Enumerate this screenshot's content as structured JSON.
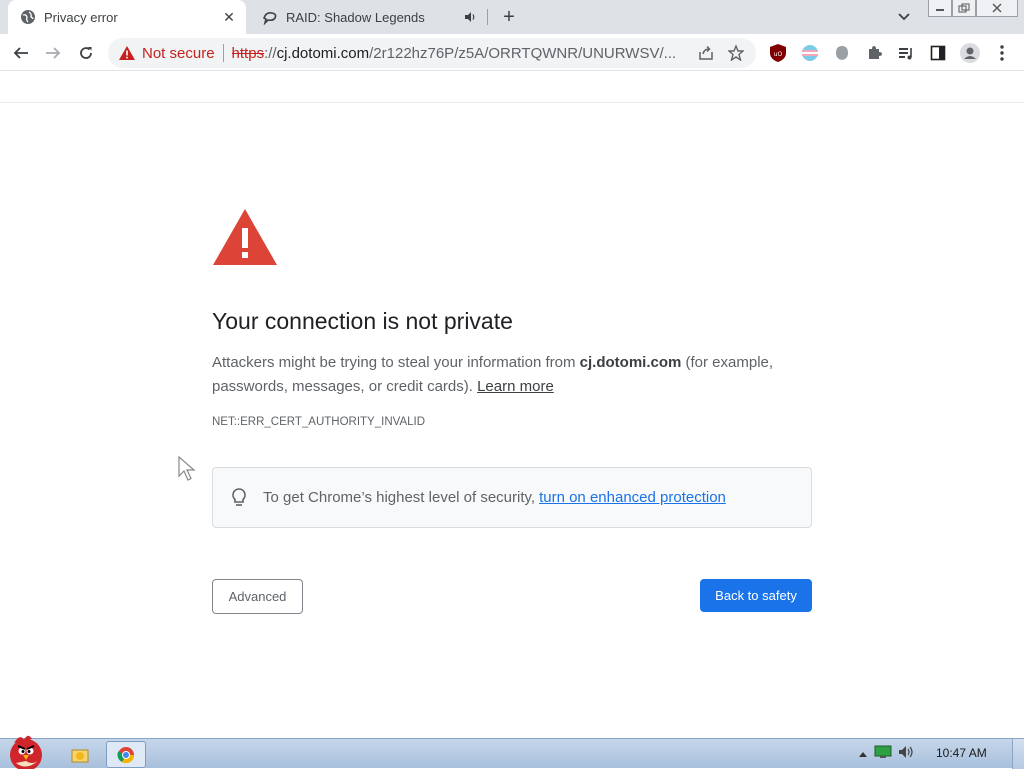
{
  "browser": {
    "tabs": [
      {
        "title": "Privacy error",
        "icon": "globe-icon",
        "close": "✕"
      },
      {
        "title": "RAID: Shadow Legends",
        "icon": "raid-logo-icon",
        "audio_icon": "speaker-icon"
      }
    ],
    "new_tab_symbol": "+",
    "address_bar": {
      "security_label": "Not secure",
      "url_scheme": "https",
      "url_host": "cj.dotomi.com",
      "url_path": "/2r122hz76P/z5A/ORRTQWNR/UNURWSV/..."
    },
    "extensions": [
      "ublock-icon",
      "flag-icon",
      "shield-icon",
      "puzzle-icon",
      "media-icon",
      "sidepanel-icon",
      "profile-icon",
      "menu-icon"
    ]
  },
  "page": {
    "heading": "Your connection is not private",
    "desc_prefix": "Attackers might be trying to steal your information from ",
    "desc_host": "cj.dotomi.com",
    "desc_suffix": " (for example, passwords, messages, or credit cards). ",
    "learn_more": "Learn more",
    "error_code": "NET::ERR_CERT_AUTHORITY_INVALID",
    "enhanced_text": "To get Chrome’s highest level of security, ",
    "enhanced_link": "turn on enhanced protection",
    "advanced_button": "Advanced",
    "back_button": "Back to safety",
    "colors": {
      "accent": "#1a73e8",
      "error": "#d93025"
    }
  },
  "taskbar": {
    "clock": "10:47 AM"
  }
}
